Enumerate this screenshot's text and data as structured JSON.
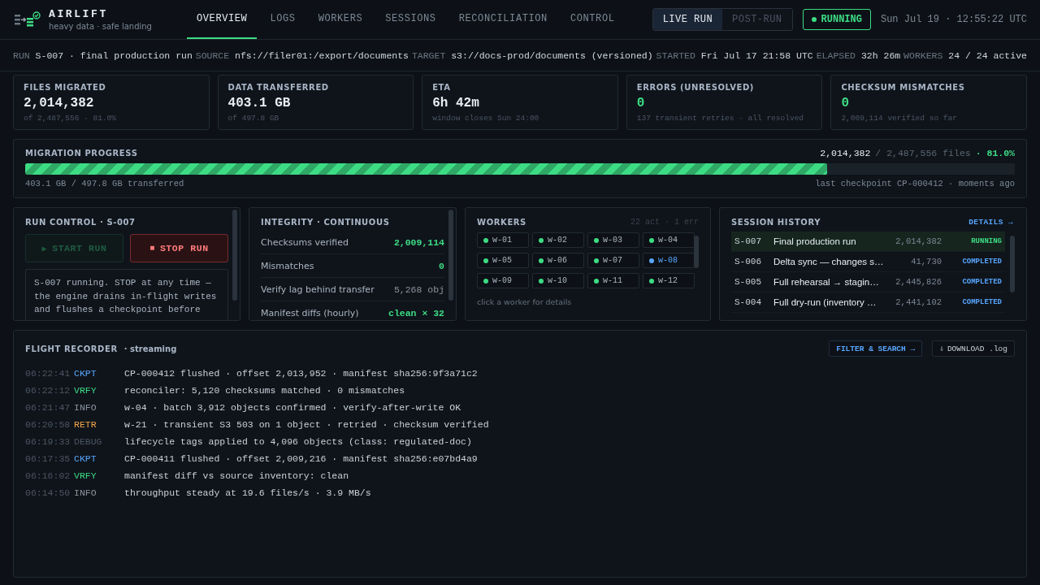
{
  "brand": {
    "name": "AIRLIFT",
    "tagline": "heavy data · safe landing"
  },
  "tabs": [
    {
      "label": "OVERVIEW",
      "selected": true
    },
    {
      "label": "LOGS",
      "selected": false
    },
    {
      "label": "WORKERS",
      "selected": false
    },
    {
      "label": "SESSIONS",
      "selected": false
    },
    {
      "label": "RECONCILIATION",
      "selected": false
    },
    {
      "label": "CONTROL",
      "selected": false
    }
  ],
  "mode_toggle": [
    {
      "label": "LIVE RUN",
      "selected": true
    },
    {
      "label": "POST-RUN",
      "selected": false
    }
  ],
  "status": {
    "label": "RUNNING",
    "on": true
  },
  "clock": "Sun Jul 19 · 12:55:22 UTC",
  "run_info": [
    {
      "label": "RUN",
      "value": "S-007 · final production run"
    },
    {
      "label": "SOURCE",
      "value": "nfs://filer01:/export/documents"
    },
    {
      "label": "TARGET",
      "value": "s3://docs-prod/documents (versioned)"
    },
    {
      "label": "STARTED",
      "value": "Fri Jul 17 21:58 UTC"
    },
    {
      "label": "ELAPSED",
      "value": "32h 26m"
    },
    {
      "label": "WORKERS",
      "value": "24 / 24 active"
    }
  ],
  "stats": [
    {
      "label": "FILES MIGRATED",
      "value": "2,014,382",
      "note": "of 2,487,556 · 81.0%",
      "highlight": false
    },
    {
      "label": "DATA TRANSFERRED",
      "value": "403.1 GB",
      "note": "of 497.8 GB",
      "highlight": false
    },
    {
      "label": "ETA",
      "value": "6h 42m",
      "note": "window closes Sun 24:00",
      "highlight": false
    },
    {
      "label": "ERRORS (UNRESOLVED)",
      "value": "0",
      "note": "137 transient retries · all resolved",
      "highlight": true
    },
    {
      "label": "CHECKSUM MISMATCHES",
      "value": "0",
      "note": "2,009,114 verified so far",
      "highlight": true
    }
  ],
  "progress": {
    "title": "MIGRATION PROGRESS",
    "done": "2,014,382",
    "total": "/ 2,487,556 files",
    "percent": "· 81.0%",
    "level": 0.81,
    "transferred": "403.1 GB / 497.8 GB transferred",
    "checkpoint": "last checkpoint CP-000412 · moments ago"
  },
  "run_control": {
    "title": "RUN CONTROL · S-007",
    "buttons": [
      {
        "kind": "start",
        "icon": "▶",
        "label": "START RUN",
        "disabled": true
      },
      {
        "kind": "stop",
        "icon": "■",
        "label": "STOP RUN",
        "disabled": false
      }
    ],
    "note": "S-007 running. STOP at any time — the engine drains in-flight writes and flushes a checkpoint before"
  },
  "integrity": {
    "title": "INTEGRITY · CONTINUOUS",
    "rows": [
      {
        "label": "Checksums verified",
        "value": "2,009,114",
        "highlight": true
      },
      {
        "label": "Mismatches",
        "value": "0",
        "highlight": true
      },
      {
        "label": "Verify lag behind transfer",
        "value": "5,268 obj",
        "highlight": false
      },
      {
        "label": "Manifest diffs (hourly)",
        "value": "clean × 32",
        "highlight": true
      }
    ]
  },
  "workers": {
    "title": "WORKERS",
    "summary": "22 act · 1 err",
    "hint": "click a worker for details",
    "items": [
      {
        "name": "w-01",
        "color": "#3ddc84"
      },
      {
        "name": "w-02",
        "color": "#3ddc84"
      },
      {
        "name": "w-03",
        "color": "#3ddc84"
      },
      {
        "name": "w-04",
        "color": "#3ddc84"
      },
      {
        "name": "w-05",
        "color": "#3ddc84"
      },
      {
        "name": "w-06",
        "color": "#3ddc84"
      },
      {
        "name": "w-07",
        "color": "#3ddc84"
      },
      {
        "name": "w-08",
        "color": "#58a6ff"
      },
      {
        "name": "w-09",
        "color": "#3ddc84"
      },
      {
        "name": "w-10",
        "color": "#3ddc84"
      },
      {
        "name": "w-11",
        "color": "#3ddc84"
      },
      {
        "name": "w-12",
        "color": "#3ddc84"
      }
    ]
  },
  "sessions": {
    "title": "SESSION HISTORY",
    "link": "DETAILS →",
    "rows": [
      {
        "id": "S-007",
        "name": "Final production run",
        "files": "2,014,382",
        "status": "RUNNING",
        "kind": "running",
        "selected": true
      },
      {
        "id": "S-006",
        "name": "Delta sync — changes s…",
        "files": "41,730",
        "status": "COMPLETED",
        "kind": "completed",
        "selected": false
      },
      {
        "id": "S-005",
        "name": "Full rehearsal → stagin…",
        "files": "2,445,826",
        "status": "COMPLETED",
        "kind": "completed",
        "selected": false
      },
      {
        "id": "S-004",
        "name": "Full dry-run (inventory …",
        "files": "2,441,102",
        "status": "COMPLETED",
        "kind": "completed",
        "selected": false
      }
    ]
  },
  "recorder": {
    "title": "FLIGHT RECORDER",
    "subtitle": "· streaming",
    "buttons": [
      {
        "kind": "link",
        "label": "FILTER & SEARCH →"
      },
      {
        "kind": "download",
        "icon": "⇩",
        "label": "DOWNLOAD .log"
      }
    ],
    "entries": [
      {
        "time": "06:22:41",
        "kind": "CKPT",
        "message": "CP-000412 flushed · offset 2,013,952 · manifest sha256:9f3a71c2"
      },
      {
        "time": "06:22:12",
        "kind": "VRFY",
        "message": "reconciler: 5,120 checksums matched · 0 mismatches"
      },
      {
        "time": "06:21:47",
        "kind": "INFO",
        "message": "w-04 · batch 3,912 objects confirmed · verify-after-write OK"
      },
      {
        "time": "06:20:58",
        "kind": "RETR",
        "message": "w-21 · transient S3 503 on 1 object · retried · checksum verified"
      },
      {
        "time": "06:19:33",
        "kind": "DEBUG",
        "message": "lifecycle tags applied to 4,096 objects (class: regulated-doc)"
      },
      {
        "time": "06:17:35",
        "kind": "CKPT",
        "message": "CP-000411 flushed · offset 2,009,216 · manifest sha256:e07bd4a9"
      },
      {
        "time": "06:16:02",
        "kind": "VRFY",
        "message": "manifest diff vs source inventory: clean"
      },
      {
        "time": "06:14:50",
        "kind": "INFO",
        "message": "throughput steady at 19.6 files/s · 3.9 MB/s"
      }
    ]
  }
}
